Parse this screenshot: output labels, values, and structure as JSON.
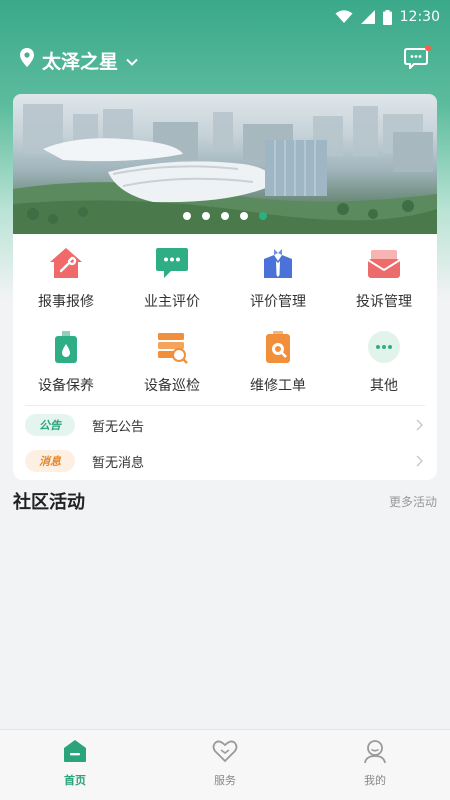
{
  "status_bar": {
    "time": "12:30"
  },
  "header": {
    "location": "太泽之星"
  },
  "banner": {
    "dot_count": 5,
    "active_dot": 4
  },
  "grid": [
    {
      "label": "报事报修",
      "icon": "wrench-house-icon"
    },
    {
      "label": "业主评价",
      "icon": "chat-bubble-icon"
    },
    {
      "label": "评价管理",
      "icon": "staff-icon"
    },
    {
      "label": "投诉管理",
      "icon": "mail-icon"
    },
    {
      "label": "设备保养",
      "icon": "oil-can-icon"
    },
    {
      "label": "设备巡检",
      "icon": "inspection-icon"
    },
    {
      "label": "维修工单",
      "icon": "work-order-icon"
    },
    {
      "label": "其他",
      "icon": "more-icon"
    }
  ],
  "notices": [
    {
      "badge": "公告",
      "text": "暂无公告"
    },
    {
      "badge": "消息",
      "text": "暂无消息"
    }
  ],
  "section": {
    "title": "社区活动",
    "more": "更多活动"
  },
  "tabs": [
    {
      "label": "首页",
      "icon": "home-icon",
      "active": true
    },
    {
      "label": "服务",
      "icon": "heart-icon",
      "active": false
    },
    {
      "label": "我的",
      "icon": "profile-icon",
      "active": false
    }
  ],
  "colors": {
    "primary": "#2aa47a",
    "badge_orange": "#e5862c",
    "badge_dot": "#ff5a4a"
  }
}
